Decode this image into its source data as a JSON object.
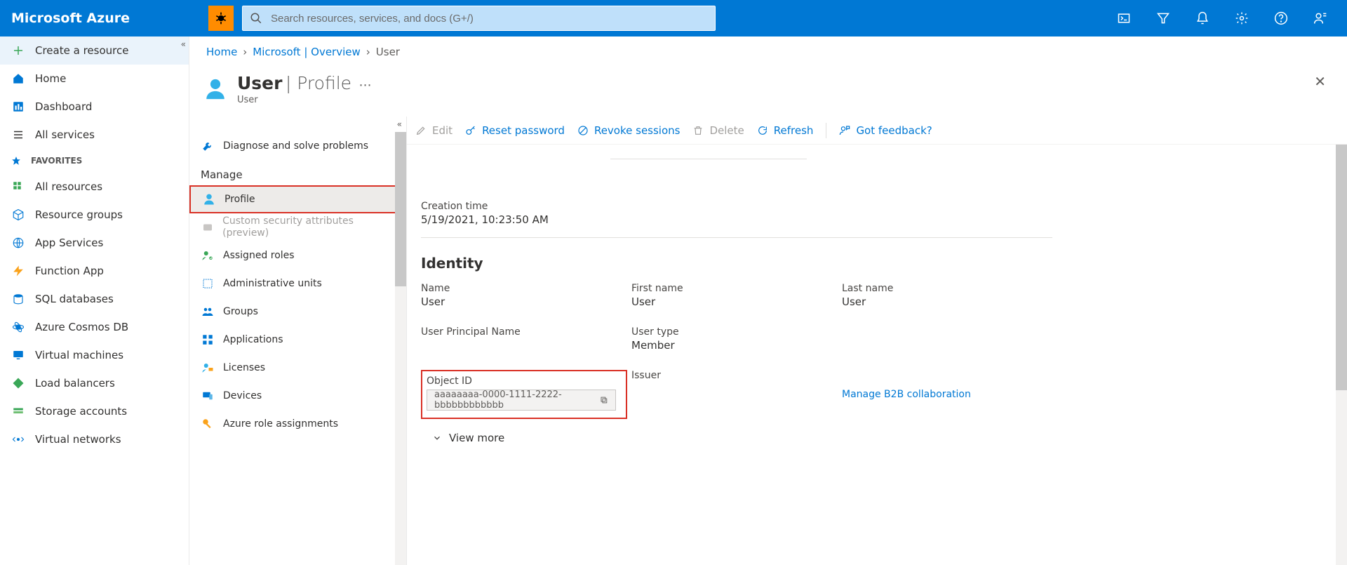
{
  "brand": "Microsoft Azure",
  "search": {
    "placeholder": "Search resources, services, and docs (G+/)"
  },
  "sidebar": {
    "create_label": "Create a resource",
    "items": [
      {
        "icon": "home",
        "label": "Home"
      },
      {
        "icon": "dashboard",
        "label": "Dashboard"
      },
      {
        "icon": "list",
        "label": "All services"
      }
    ],
    "favorites_header": "FAVORITES",
    "favorites": [
      {
        "icon": "grid",
        "label": "All resources"
      },
      {
        "icon": "cube",
        "label": "Resource groups"
      },
      {
        "icon": "globe",
        "label": "App Services"
      },
      {
        "icon": "bolt",
        "label": "Function App"
      },
      {
        "icon": "sql",
        "label": "SQL databases"
      },
      {
        "icon": "cosmos",
        "label": "Azure Cosmos DB"
      },
      {
        "icon": "vm",
        "label": "Virtual machines"
      },
      {
        "icon": "lb",
        "label": "Load balancers"
      },
      {
        "icon": "storage",
        "label": "Storage accounts"
      },
      {
        "icon": "vnet",
        "label": "Virtual networks"
      }
    ]
  },
  "breadcrumb": [
    {
      "label": "Home",
      "link": true
    },
    {
      "label": "Microsoft | Overview",
      "link": true
    },
    {
      "label": "User",
      "link": false
    }
  ],
  "page": {
    "title": "User",
    "subtitle": "Profile",
    "type": "User"
  },
  "midnav": {
    "top": [
      {
        "icon": "wrench",
        "label": "Diagnose and solve problems"
      }
    ],
    "section": "Manage",
    "items": [
      {
        "icon": "user",
        "label": "Profile",
        "selected": true
      },
      {
        "icon": "badge",
        "label": "Custom security attributes (preview)",
        "disabled": true
      },
      {
        "icon": "roles",
        "label": "Assigned roles"
      },
      {
        "icon": "admin",
        "label": "Administrative units"
      },
      {
        "icon": "groups",
        "label": "Groups"
      },
      {
        "icon": "apps",
        "label": "Applications"
      },
      {
        "icon": "lic",
        "label": "Licenses"
      },
      {
        "icon": "dev",
        "label": "Devices"
      },
      {
        "icon": "key",
        "label": "Azure role assignments"
      }
    ]
  },
  "commands": {
    "edit": "Edit",
    "reset": "Reset password",
    "revoke": "Revoke sessions",
    "delete": "Delete",
    "refresh": "Refresh",
    "feedback": "Got feedback?"
  },
  "details": {
    "creation_time_label": "Creation time",
    "creation_time": "5/19/2021, 10:23:50 AM",
    "identity_heading": "Identity",
    "name_label": "Name",
    "name": "User",
    "first_label": "First name",
    "first": "User",
    "last_label": "Last name",
    "last": "User",
    "upn_label": "User Principal Name",
    "usertype_label": "User type",
    "usertype": "Member",
    "objectid_label": "Object ID",
    "objectid": "aaaaaaaa-0000-1111-2222-bbbbbbbbbbbb",
    "issuer_label": "Issuer",
    "manage_b2b": "Manage B2B collaboration",
    "view_more": "View more"
  }
}
